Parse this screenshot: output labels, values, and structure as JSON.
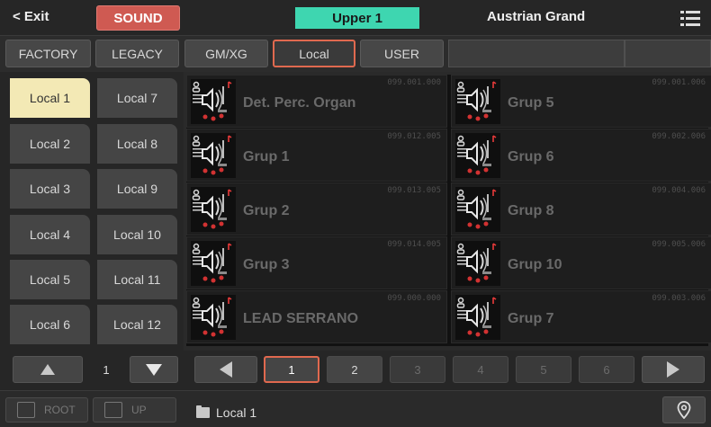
{
  "topbar": {
    "exit_label": "< Exit",
    "sound_label": "SOUND",
    "upper_label": "Upper 1",
    "current_sound": "Austrian Grand",
    "menu_icon": "hamburger-menu-icon"
  },
  "tabs": [
    "FACTORY",
    "LEGACY",
    "GM/XG",
    "Local",
    "USER"
  ],
  "active_tab": "Local",
  "banks": {
    "left": [
      "Local 1",
      "Local 2",
      "Local 3",
      "Local 4",
      "Local 5",
      "Local 6"
    ],
    "right": [
      "Local 7",
      "Local 8",
      "Local 9",
      "Local 10",
      "Local 11",
      "Local 12"
    ]
  },
  "active_bank": "Local 1",
  "sounds": {
    "left": [
      {
        "name": "Det. Perc. Organ",
        "code": "099.001.000"
      },
      {
        "name": "Grup 1",
        "code": "099.012.005"
      },
      {
        "name": "Grup 2",
        "code": "099.013.005"
      },
      {
        "name": "Grup 3",
        "code": "099.014.005"
      },
      {
        "name": "LEAD SERRANO",
        "code": "099.000.000"
      }
    ],
    "right": [
      {
        "name": "Grup 5",
        "code": "099.001.006"
      },
      {
        "name": "Grup 6",
        "code": "099.002.006"
      },
      {
        "name": "Grup 8",
        "code": "099.004.006"
      },
      {
        "name": "Grup 10",
        "code": "099.005.006"
      },
      {
        "name": "Grup 7",
        "code": "099.003.006"
      }
    ]
  },
  "bank_page": "1",
  "pages": [
    "1",
    "2",
    "3",
    "4",
    "5",
    "6"
  ],
  "active_page": "1",
  "bottom": {
    "root_label": "ROOT",
    "up_label": "UP",
    "path": "Local 1"
  },
  "colors": {
    "accent": "#e0694f",
    "sound_button": "#cf5a52",
    "upper_highlight": "#3ed6b0",
    "active_bank": "#f3e9b5"
  }
}
